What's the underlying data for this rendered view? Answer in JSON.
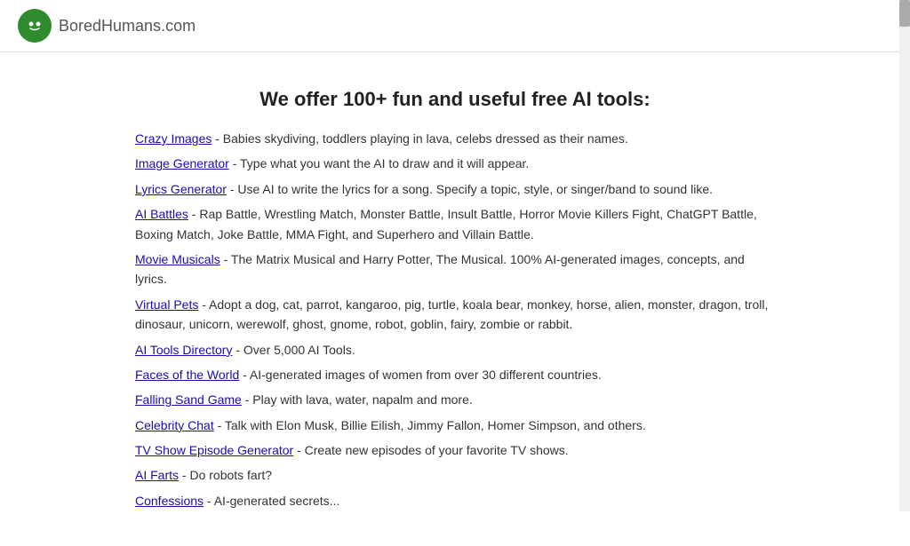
{
  "header": {
    "logo_name": "BoredHumans",
    "logo_tld": ".com"
  },
  "main": {
    "heading": "We offer 100+ fun and useful free AI tools:",
    "tools": [
      {
        "name": "Crazy Images",
        "description": " - Babies skydiving, toddlers playing in lava, celebs dressed as their names."
      },
      {
        "name": "Image Generator",
        "description": " - Type what you want the AI to draw and it will appear."
      },
      {
        "name": "Lyrics Generator",
        "description": " - Use AI to write the lyrics for a song. Specify a topic, style, or singer/band to sound like."
      },
      {
        "name": "AI Battles",
        "description": " - Rap Battle, Wrestling Match, Monster Battle, Insult Battle, Horror Movie Killers Fight, ChatGPT Battle, Boxing Match, Joke Battle, MMA Fight, and Superhero and Villain Battle."
      },
      {
        "name": "Movie Musicals",
        "description": " - The Matrix Musical and Harry Potter, The Musical. 100% AI-generated images, concepts, and lyrics."
      },
      {
        "name": "Virtual Pets",
        "description": " - Adopt a dog, cat, parrot, kangaroo, pig, turtle, koala bear, monkey, horse, alien, monster, dragon, troll, dinosaur, unicorn, werewolf, ghost, gnome, robot, goblin, fairy, zombie or rabbit."
      },
      {
        "name": "AI Tools Directory",
        "description": " - Over 5,000 AI Tools."
      },
      {
        "name": "Faces of the World",
        "description": " - AI-generated images of women from over 30 different countries."
      },
      {
        "name": "Falling Sand Game",
        "description": " - Play with lava, water, napalm and more."
      },
      {
        "name": "Celebrity Chat",
        "description": " - Talk with Elon Musk, Billie Eilish, Jimmy Fallon, Homer Simpson, and others."
      },
      {
        "name": "TV Show Episode Generator",
        "description": " - Create new episodes of your favorite TV shows."
      },
      {
        "name": "AI Farts",
        "description": " - Do robots fart?"
      },
      {
        "name": "Confessions",
        "description": " - AI-generated secrets..."
      }
    ]
  }
}
